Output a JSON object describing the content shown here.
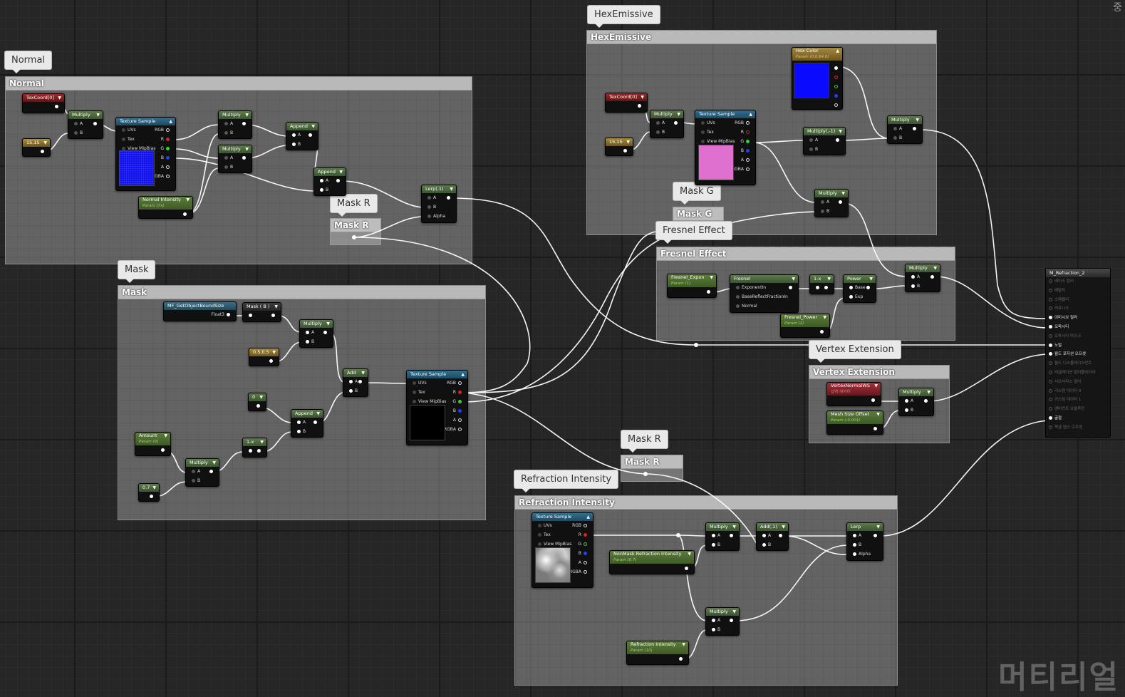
{
  "comments": {
    "normal": "Normal",
    "hex_emissive": "HexEmissive",
    "mask": "Mask",
    "fresnel": "Fresnel Effect",
    "vertex": "Vertex Extension",
    "refraction": "Refraction Intensity",
    "mask_r_top": "Mask R",
    "mask_g": "Mask G",
    "mask_r_bottom": "Mask R"
  },
  "nodes": {
    "texcoord": "TexCoord[0]",
    "c1515": "15,15",
    "multiply": "Multiply",
    "multiply_neg1": "Multiply(,-1)",
    "texture_sample": "Texture Sample",
    "append": "Append",
    "lerp": "Lerp",
    "lerp_1": "Lerp(,1)",
    "add": "Add",
    "add_1": "Add(,1)",
    "normal_intensity": "Normal Intensity",
    "normal_intensity_param": "Param (7x)",
    "hex_color": "Hex Color",
    "hex_color_param": "Param (0,0,64,0)",
    "mf_bound": "MF_GetObjectBoundSize",
    "float3": "Float3",
    "mask_b": "Mask ( B )",
    "c050505": "0.5,0.5",
    "c0": "0",
    "amount": "Amount",
    "amount_param": "Param (0)",
    "c07": "0.7",
    "one_minus": "1-x",
    "fresnel_expon": "Fresnel_Expon",
    "fresnel_expon_param": "Param (1)",
    "fresnel": "Fresnel",
    "fresnel_power": "Fresnel_Power",
    "fresnel_power_param": "Param (2)",
    "power": "Power",
    "vertex_normal": "VertexNormalWS",
    "vertex_normal_sub": "입력 데이터",
    "mesh_size_offset": "Mesh Size Offset",
    "mesh_size_offset_param": "Param (-0.001)",
    "nonmask_refraction": "NonMask Refraction Intensity",
    "nonmask_refraction_param": "Param (0.7)",
    "refraction_intensity": "Refraction Intensity",
    "refraction_intensity_param": "Param (10)",
    "result": "M_Refraction_2"
  },
  "pins": {
    "uvs": "UVs",
    "tex": "Tex",
    "view_mip_bias": "View MipBias",
    "rgb": "RGB",
    "r": "R",
    "g": "G",
    "b": "B",
    "a": "A",
    "rgba": "RGBA",
    "A": "A",
    "B": "B",
    "alpha": "Alpha",
    "base": "Base",
    "exp": "Exp",
    "exponent_in": "ExponentIn",
    "base_reflect": "BaseReflectFractionIn",
    "normal": "Normal"
  },
  "result_pins": [
    {
      "label": "베이스 컬러",
      "connected": false
    },
    {
      "label": "메탈릭",
      "connected": false
    },
    {
      "label": "스페큘러",
      "connected": false
    },
    {
      "label": "러프니스",
      "connected": false
    },
    {
      "label": "이미시브 컬러",
      "connected": true
    },
    {
      "label": "오파시티",
      "connected": true
    },
    {
      "label": "오파시티 마스크",
      "connected": false
    },
    {
      "label": "노멀",
      "connected": true
    },
    {
      "label": "월드 포지션 오프셋",
      "connected": true
    },
    {
      "label": "월드 디스플레이스먼트",
      "connected": false
    },
    {
      "label": "테셀레이션 멀티플라이어",
      "connected": false
    },
    {
      "label": "서브서피스 컬러",
      "connected": false
    },
    {
      "label": "커스텀 데이터 0",
      "connected": false
    },
    {
      "label": "커스텀 데이터 1",
      "connected": false
    },
    {
      "label": "앰비언트 오클루전",
      "connected": false
    },
    {
      "label": "굴절",
      "connected": true
    },
    {
      "label": "픽셀 뎁스 오프셋",
      "connected": false
    }
  ],
  "colors": {
    "hex_color_preview": "#0a0aff",
    "normal_preview": "#1010ee",
    "hex_texture_preview": "#e070d0",
    "mask_preview": "#000000",
    "wire": "#ffffff"
  },
  "watermark": "머티리얼",
  "corner_mark": "중"
}
